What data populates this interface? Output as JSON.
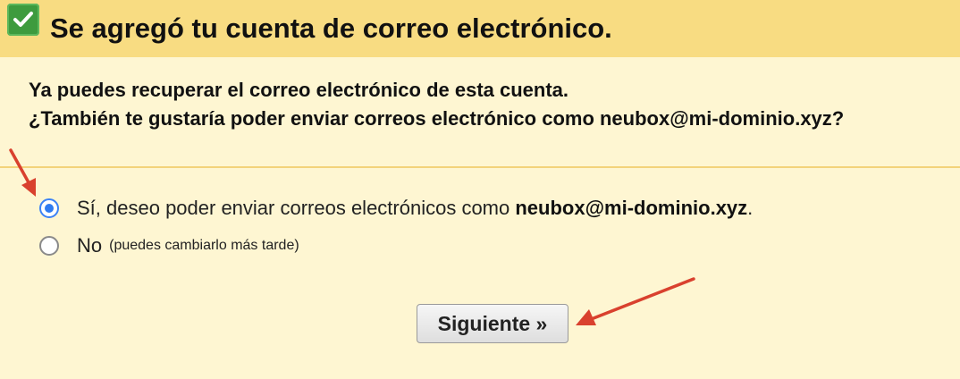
{
  "header": {
    "title": "Se agregó tu cuenta de correo electrónico.",
    "icon": "checkbox-checked-icon",
    "background": "#f8dc82"
  },
  "intro": {
    "line1": "Ya puedes recuperar el correo electrónico de esta cuenta.",
    "line2": "¿También te gustaría poder enviar correos electrónico como neubox@mi-dominio.xyz?"
  },
  "options": {
    "yes": {
      "text_before": "Sí, deseo poder enviar correos electrónicos como ",
      "email": "neubox@mi-dominio.xyz",
      "text_after": ".",
      "selected": true
    },
    "no": {
      "label": "No",
      "note": "(puedes cambiarlo más tarde)",
      "selected": false
    }
  },
  "next_button": {
    "label": "Siguiente »"
  },
  "colors": {
    "page_background": "#fef6d2",
    "accent_radio": "#2f7bf0",
    "annotation_arrow": "#d9412e"
  }
}
